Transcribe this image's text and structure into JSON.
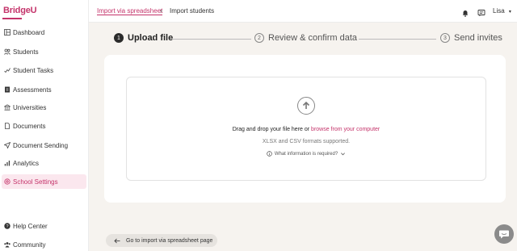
{
  "app": {
    "logo": "BridgeU"
  },
  "sidebar": {
    "items": [
      {
        "label": "Dashboard",
        "icon": "dashboard-icon"
      },
      {
        "label": "Students",
        "icon": "students-icon"
      },
      {
        "label": "Student Tasks",
        "icon": "tasks-icon"
      },
      {
        "label": "Assessments",
        "icon": "assessments-icon"
      },
      {
        "label": "Universities",
        "icon": "universities-icon"
      },
      {
        "label": "Documents",
        "icon": "documents-icon"
      },
      {
        "label": "Document Sending",
        "icon": "send-icon"
      },
      {
        "label": "Analytics",
        "icon": "analytics-icon"
      },
      {
        "label": "School Settings",
        "icon": "settings-icon",
        "active": true
      }
    ],
    "bottom_items": [
      {
        "label": "Help Center",
        "icon": "help-icon"
      },
      {
        "label": "Community",
        "icon": "community-icon"
      }
    ]
  },
  "header": {
    "breadcrumb_link": "Import via spreadsheet",
    "breadcrumb_current": "Import students",
    "user_name": "Lisa"
  },
  "stepper": {
    "steps": [
      {
        "number": "1",
        "label": "Upload file",
        "active": true
      },
      {
        "number": "2",
        "label": "Review & confirm data",
        "active": false
      },
      {
        "number": "3",
        "label": "Send invites",
        "active": false
      }
    ]
  },
  "upload": {
    "drop_text": "Drag and drop your file here or",
    "browse_link": "browse from your computer",
    "formats": "XLSX and CSV formats supported.",
    "info_link": "What information is required?"
  },
  "footer": {
    "back_button": "Go to import via spreadsheet page"
  },
  "colors": {
    "accent": "#c4336a",
    "background": "#f6f3ef",
    "active_nav_bg": "#fbe7ee"
  }
}
